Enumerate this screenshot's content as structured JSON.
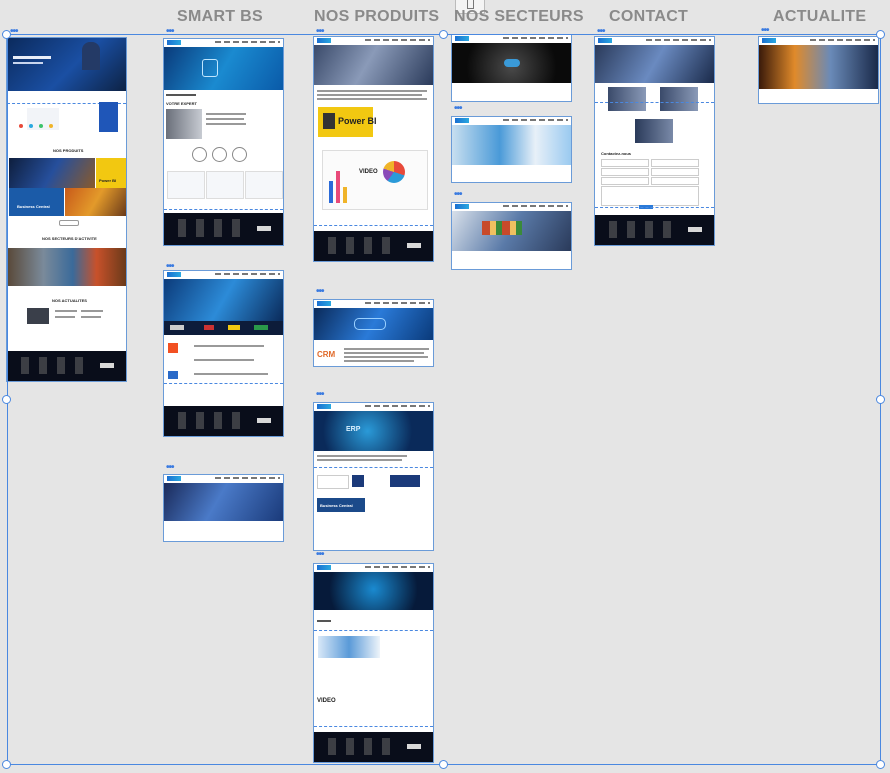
{
  "columns": {
    "smart_bs": "SMART BS",
    "nos_produits": "NOS PRODUITS",
    "nos_secteurs": "NOS SECTEURS",
    "contact": "CONTACT",
    "actualite": "ACTUALITE"
  },
  "home_page": {
    "nos_produits": "NOS PRODUITS",
    "nos_secteurs": "NOS SECTEURS D'ACTIVITE",
    "nos_actualites": "NOS ACTUALITES",
    "power_bi": "Power BI",
    "business_central": "Business Central"
  },
  "smart_bs_page": {
    "votre_expert": "VOTRE EXPERT",
    "power_bi": "Power BI",
    "video": "VIDEO"
  },
  "crm_page": {
    "crm": "CRM"
  },
  "erp_page": {
    "erp": "ERP",
    "business_central": "Business Central"
  },
  "products_page4": {
    "video": "VIDEO"
  },
  "contact_page": {
    "contactez_nous": "Contactez-nous"
  },
  "colors": {
    "accent": "#4a88e0",
    "column_title": "#8a8a8a",
    "footer": "#090d1a"
  }
}
